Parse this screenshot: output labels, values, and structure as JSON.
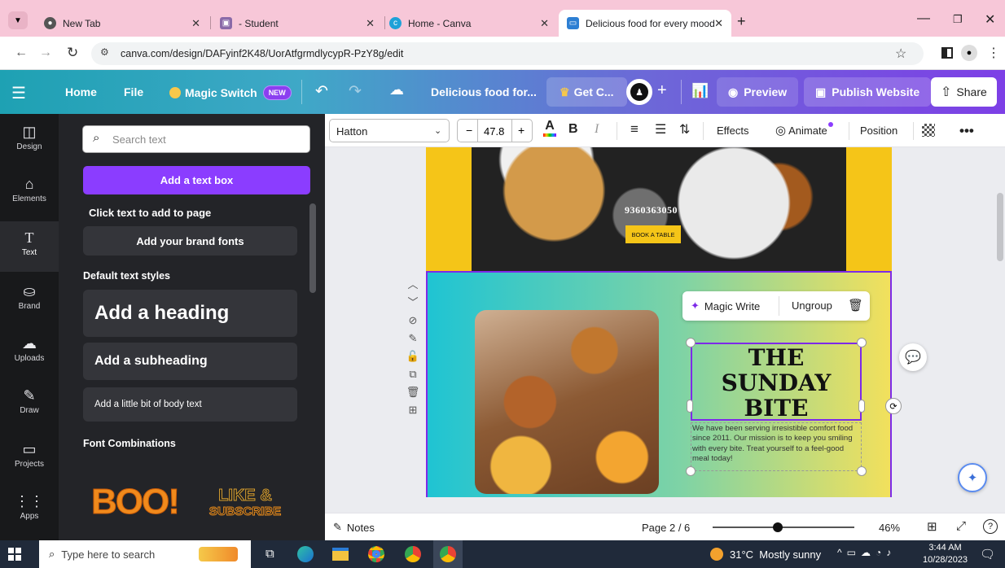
{
  "browser": {
    "tabs": [
      {
        "title": "New Tab"
      },
      {
        "title": "- Student"
      },
      {
        "title": "Home - Canva"
      },
      {
        "title": "Delicious food for every mood"
      }
    ],
    "url": "canva.com/design/DAFyinf2K48/UorAtfgrmdlycypR-PzY8g/edit"
  },
  "canva_header": {
    "home": "Home",
    "file": "File",
    "magic_switch": "Magic Switch",
    "new_badge": "NEW",
    "doc_title": "Delicious food for...",
    "get_canva": "Get C...",
    "preview": "Preview",
    "publish": "Publish Website",
    "share": "Share"
  },
  "rail": [
    {
      "label": "Design",
      "icon": "design-icon"
    },
    {
      "label": "Elements",
      "icon": "elements-icon"
    },
    {
      "label": "Text",
      "icon": "text-icon"
    },
    {
      "label": "Brand",
      "icon": "brand-icon"
    },
    {
      "label": "Uploads",
      "icon": "uploads-icon"
    },
    {
      "label": "Draw",
      "icon": "draw-icon"
    },
    {
      "label": "Projects",
      "icon": "projects-icon"
    },
    {
      "label": "Apps",
      "icon": "apps-icon"
    }
  ],
  "panel": {
    "search_placeholder": "Search text",
    "add_text_box": "Add a text box",
    "click_text": "Click text to add to page",
    "brand_fonts": "Add your brand fonts",
    "default_styles": "Default text styles",
    "heading": "Add a heading",
    "subheading": "Add a subheading",
    "body": "Add a little bit of body text",
    "font_combinations": "Font Combinations",
    "combo1": "BOO!",
    "combo2a": "LIKE &",
    "combo2b": "SUBSCRIBE"
  },
  "toolbar": {
    "font": "Hatton",
    "size": "47.8",
    "effects": "Effects",
    "animate": "Animate",
    "position": "Position"
  },
  "design": {
    "phone": "9360363050",
    "book": "BOOK A TABLE",
    "title_line1": "THE",
    "title_line2": "SUNDAY",
    "title_line3": "BITE",
    "body": "We have been serving irresistible comfort food since 2011. Our mission is to keep you smiling with every bite. Treat yourself to a feel-good meal today!",
    "magic_write": "Magic Write",
    "ungroup": "Ungroup"
  },
  "footer": {
    "notes": "Notes",
    "page": "Page 2 / 6",
    "zoom": "46%",
    "zoom_value": 46
  },
  "taskbar": {
    "search": "Type here to search",
    "weather": "31°C  Mostly sunny",
    "time": "3:44 AM",
    "date": "10/28/2023"
  },
  "colors": {
    "accent": "#7d2ae8",
    "header_start": "#1ea1b3",
    "header_end": "#7d3fe6",
    "banner_yellow": "#f5c518"
  }
}
